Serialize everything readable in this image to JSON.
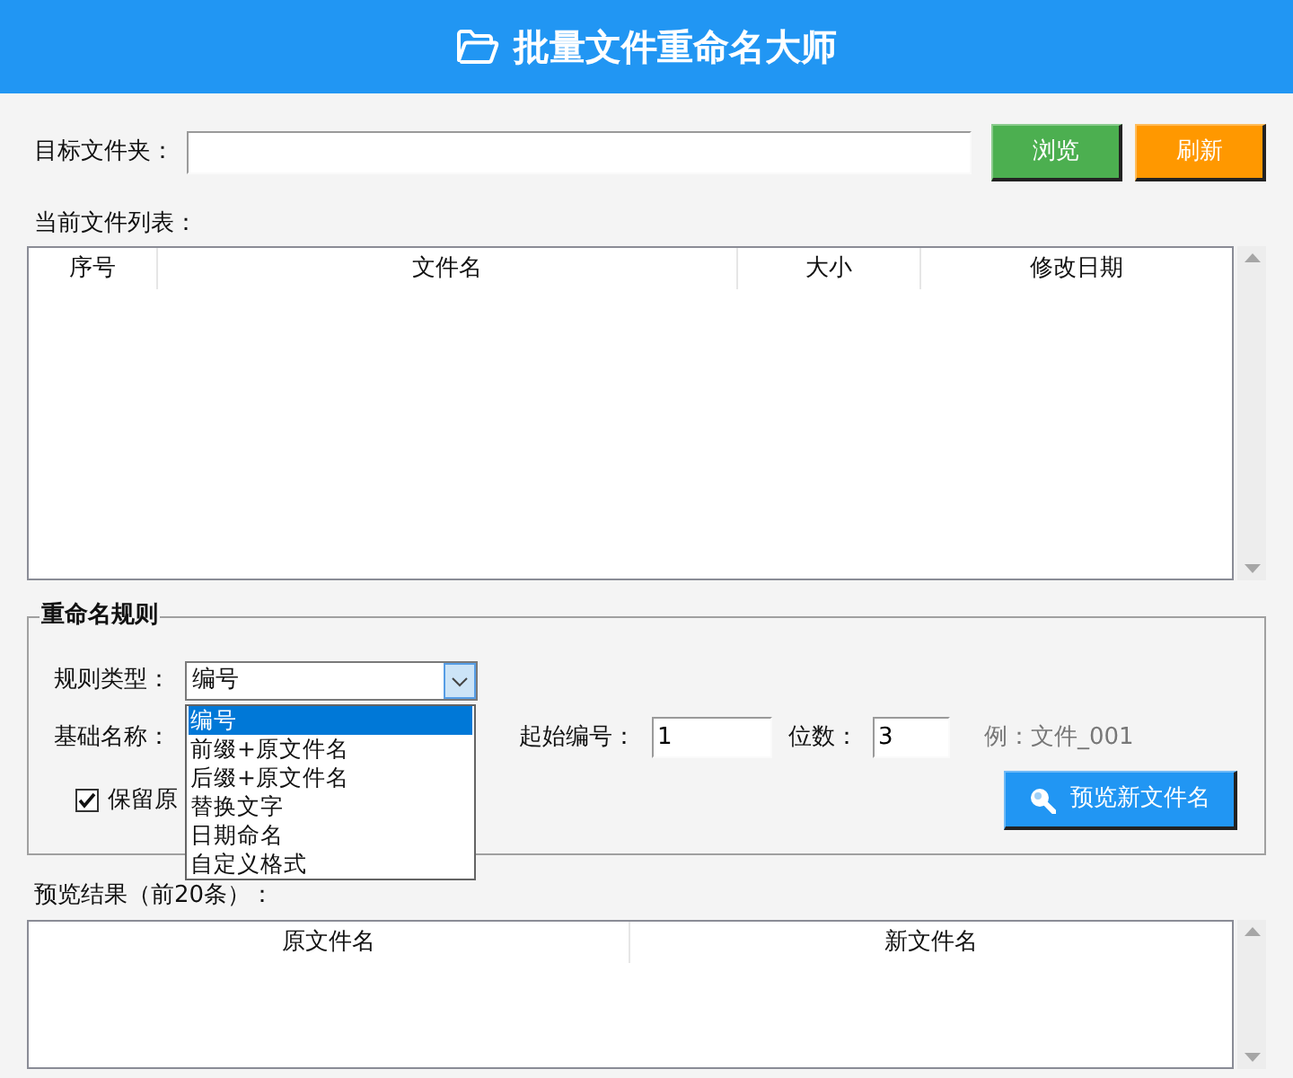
{
  "window": {
    "title": "批量文件重命名大师"
  },
  "folder": {
    "label": "目标文件夹："
  },
  "buttons": [
    {
      "label": "浏览",
      "color": "#4caf50"
    },
    {
      "label": "刷新",
      "color": "#ff9800"
    }
  ],
  "file_list": {
    "label": "当前文件列表：",
    "columns": [
      "序号",
      "文件名",
      "大小",
      "修改日期"
    ]
  },
  "rules": {
    "title": "重命名规则",
    "rule_type": {
      "label": "规则类型：",
      "value": "编号",
      "expanded": true,
      "options": [
        {
          "label": "编号",
          "selected": true
        },
        {
          "label": "前缀+原文件名",
          "selected": false
        },
        {
          "label": "后缀+原文件名",
          "selected": false
        },
        {
          "label": "替换文字",
          "selected": false
        },
        {
          "label": "日期命名",
          "selected": false
        },
        {
          "label": "自定义格式",
          "selected": false
        }
      ]
    },
    "base_name": {
      "label": "基础名称："
    },
    "start_number": {
      "label": "起始编号：",
      "value": "1"
    },
    "digits": {
      "label": "位数：",
      "value": "3"
    },
    "example": "例：文件_001",
    "keep_original": {
      "label": "保留原",
      "checked": true
    },
    "preview_button": {
      "label": "预览新文件名"
    }
  },
  "preview": {
    "label": "预览结果（前20条）：",
    "columns": [
      "原文件名",
      "新文件名"
    ]
  }
}
